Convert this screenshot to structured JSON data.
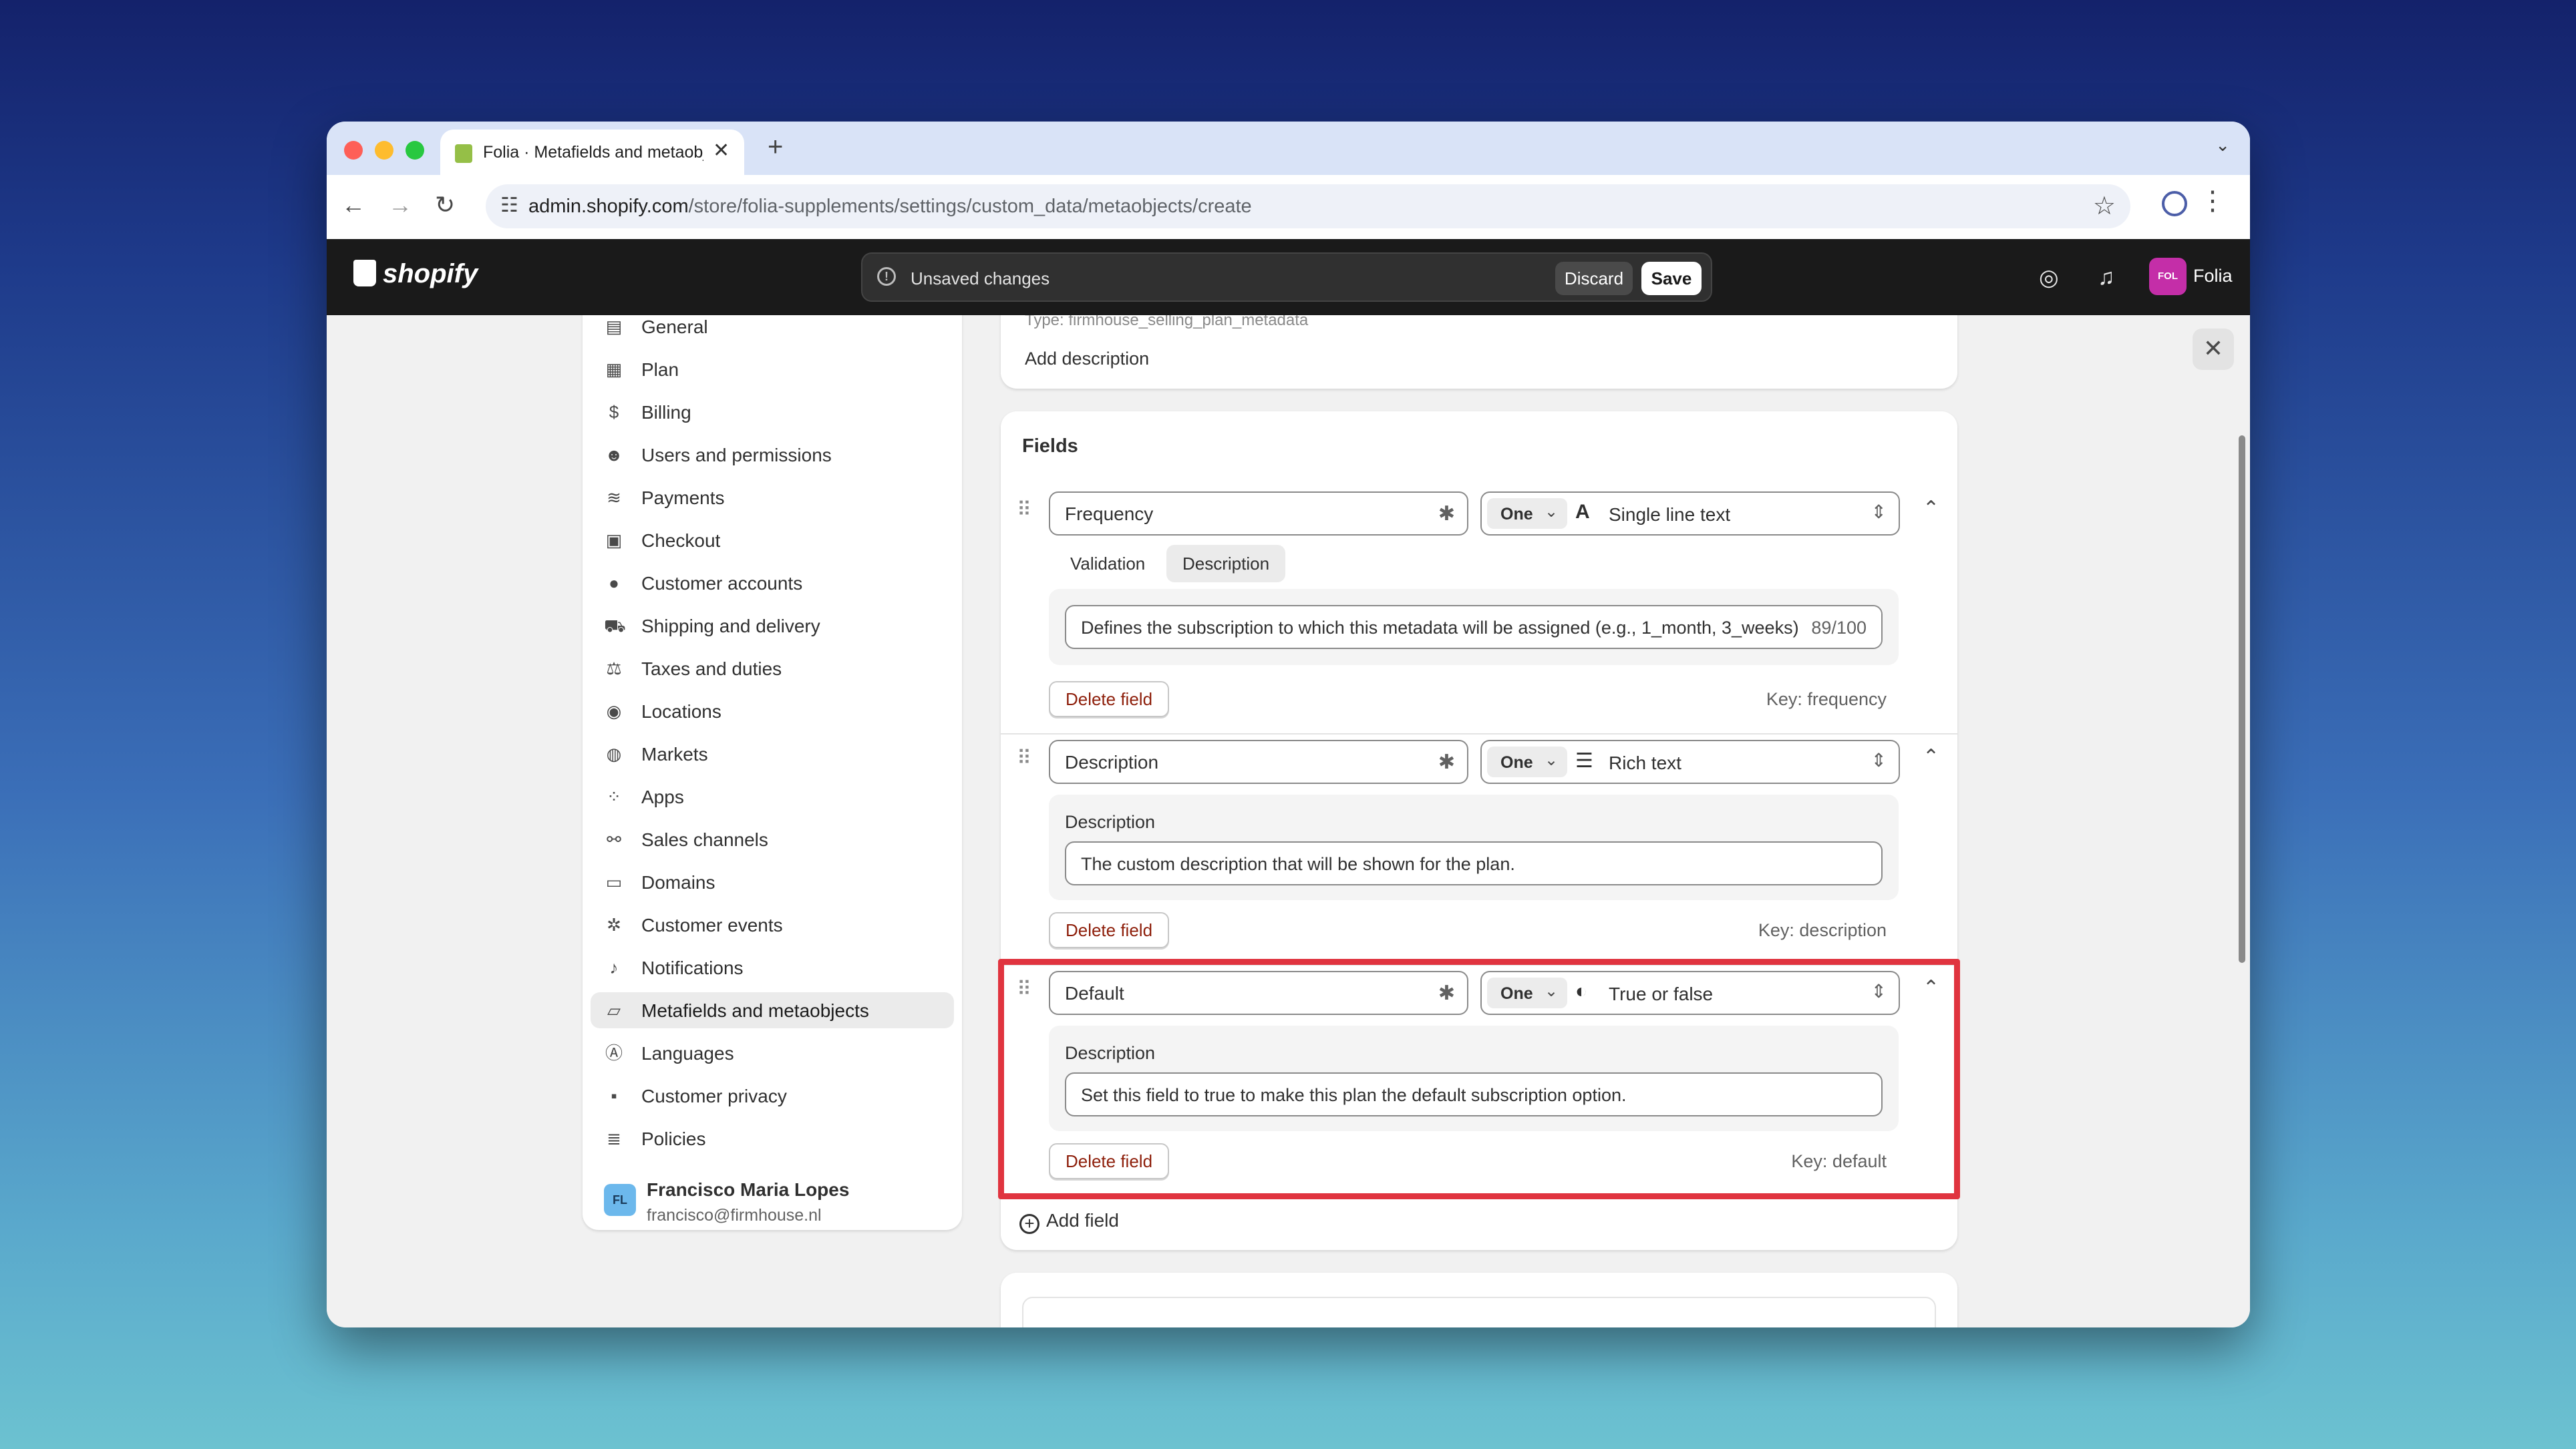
{
  "browser": {
    "tab_title": "Folia · Metafields and metaobjects",
    "tab_close": "✕",
    "new_tab": "+",
    "url_domain": "admin.shopify.com",
    "url_path": "/store/folia-supplements/settings/custom_data/metaobjects/create"
  },
  "topbar": {
    "logo": "shopify",
    "unsaved_text": "Unsaved changes",
    "discard_label": "Discard",
    "save_label": "Save",
    "store_initials": "FOL",
    "store_name": "Folia"
  },
  "sidebar": {
    "items": [
      {
        "label": "General",
        "icon": "store-icon"
      },
      {
        "label": "Plan",
        "icon": "plan-icon"
      },
      {
        "label": "Billing",
        "icon": "billing-icon"
      },
      {
        "label": "Users and permissions",
        "icon": "users-icon"
      },
      {
        "label": "Payments",
        "icon": "payments-icon"
      },
      {
        "label": "Checkout",
        "icon": "cart-icon"
      },
      {
        "label": "Customer accounts",
        "icon": "person-icon"
      },
      {
        "label": "Shipping and delivery",
        "icon": "truck-icon"
      },
      {
        "label": "Taxes and duties",
        "icon": "tax-icon"
      },
      {
        "label": "Locations",
        "icon": "location-icon"
      },
      {
        "label": "Markets",
        "icon": "globe-icon"
      },
      {
        "label": "Apps",
        "icon": "apps-icon"
      },
      {
        "label": "Sales channels",
        "icon": "channels-icon"
      },
      {
        "label": "Domains",
        "icon": "domains-icon"
      },
      {
        "label": "Customer events",
        "icon": "cursor-icon"
      },
      {
        "label": "Notifications",
        "icon": "bell-icon"
      },
      {
        "label": "Metafields and metaobjects",
        "icon": "metafields-icon",
        "active": true
      },
      {
        "label": "Languages",
        "icon": "languages-icon"
      },
      {
        "label": "Customer privacy",
        "icon": "lock-icon"
      },
      {
        "label": "Policies",
        "icon": "policies-icon"
      }
    ],
    "user_initials": "FL",
    "user_name": "Francisco Maria Lopes",
    "user_email": "francisco@firmhouse.nl"
  },
  "definition": {
    "type_text": "Type: firmhouse_selling_plan_metadata",
    "add_description": "Add description"
  },
  "fields": {
    "heading": "Fields",
    "add_field": "Add field",
    "list": [
      {
        "name": "Frequency",
        "cardinality": "One",
        "type": "Single line text",
        "type_icon": "text-icon",
        "tabs": [
          "Validation",
          "Description"
        ],
        "selected_tab": "Description",
        "description": "Defines the subscription to which this metadata will be assigned (e.g., 1_month, 3_weeks)",
        "char_count": "89/100",
        "delete_label": "Delete field",
        "key": "Key: frequency"
      },
      {
        "name": "Description",
        "cardinality": "One",
        "type": "Rich text",
        "type_icon": "rich-text-icon",
        "description_label": "Description",
        "description": "The custom description that will be shown for the plan.",
        "delete_label": "Delete field",
        "key": "Key: description"
      },
      {
        "name": "Default",
        "cardinality": "One",
        "type": "True or false",
        "type_icon": "toggle-icon",
        "description_label": "Description",
        "description": "Set this field to true to make this plan the default subscription option.",
        "delete_label": "Delete field",
        "key": "Key: default"
      }
    ]
  },
  "colors": {
    "highlight": "#e0343f",
    "shopify_green": "#95bf47",
    "store_avatar": "#c42ea8",
    "topbar": "#1a1a1a"
  }
}
